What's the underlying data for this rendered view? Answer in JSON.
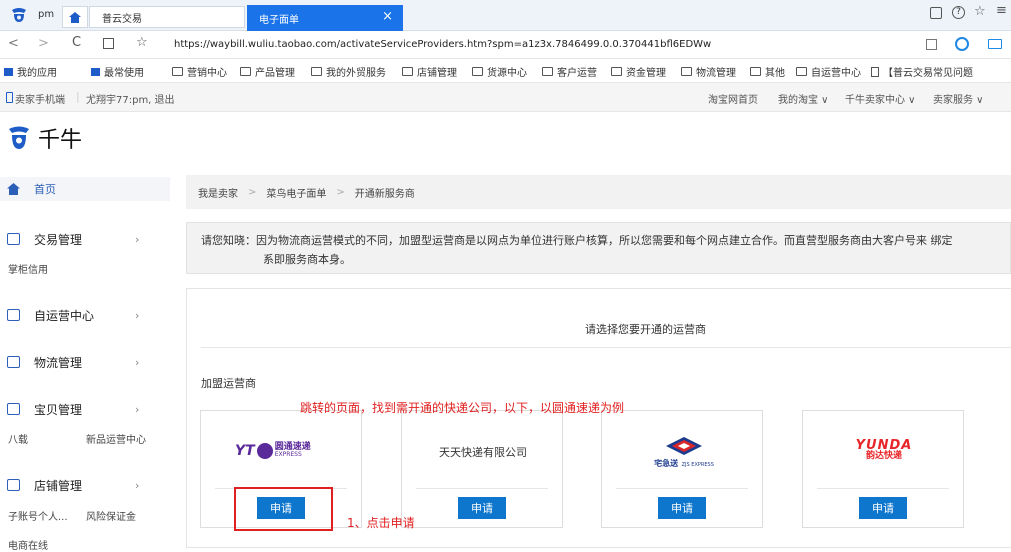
{
  "browser": {
    "tabs": [
      {
        "label": "pm"
      },
      {
        "label": "普云交易"
      },
      {
        "label": "电子面单"
      }
    ],
    "tab_close": "×",
    "url": "https://waybill.wuliu.taobao.com/activateServiceProviders.htm?spm=a1z3x.7846499.0.0.370441bfl6EDWw",
    "bookmarks": [
      "我的应用",
      "最常使用",
      "营销中心",
      "产品管理",
      "我的外贸服务",
      "店铺管理",
      "货源中心",
      "客户运营",
      "资金管理",
      "物流管理",
      "其他",
      "自运营中心",
      "【普云交易常见问题"
    ]
  },
  "sitebar": {
    "left": [
      "卖家手机端",
      "尤翔宇77:pm, 退出"
    ],
    "right": [
      "淘宝网首页",
      "我的淘宝 ∨",
      "千牛卖家中心 ∨",
      "卖家服务 ∨"
    ]
  },
  "logo": {
    "text": "千牛"
  },
  "sidebar": {
    "items": [
      {
        "label": "首页"
      },
      {
        "label": "交易管理",
        "sub": [
          "掌柜信用"
        ]
      },
      {
        "label": "自运营中心"
      },
      {
        "label": "物流管理"
      },
      {
        "label": "宝贝管理",
        "sub": [
          "八载",
          "新品运营中心"
        ]
      },
      {
        "label": "店铺管理",
        "sub": [
          "子账号个人...",
          "风险保证金",
          "电商在线"
        ]
      }
    ]
  },
  "breadcrumb": [
    "我是卖家",
    "菜鸟电子面单",
    "开通新服务商"
  ],
  "notice": {
    "line1": "请您知晓：因为物流商运营模式的不同，加盟型运营商是以网点为单位进行账户核算，所以您需要和每个网点建立合作。而直营型服务商由大客户号来 绑定",
    "line2": "系即服务商本身。"
  },
  "panel": {
    "header": "请选择您要开通的运营商",
    "section": "加盟运营商"
  },
  "carriers": [
    {
      "logo_text": "YT",
      "logo_sub": "圆通速递",
      "logo_en": "EXPRESS",
      "button": "申请"
    },
    {
      "name": "天天快递有限公司",
      "button": "申请"
    },
    {
      "logo_sub": "宅急送",
      "logo_en": "ZJS EXPRESS",
      "button": "申请"
    },
    {
      "logo_text": "YUNDA",
      "logo_sub": "韵达快递",
      "button": "申请"
    }
  ],
  "annotations": {
    "top": "跳转的页面，找到需开通的快递公司，以下，以圆通速递为例",
    "bottom": "1、点击申请",
    "color": "#e02020"
  },
  "colors": {
    "accent": "#0e76cc",
    "sidebar_icon": "#2b5fb8"
  }
}
